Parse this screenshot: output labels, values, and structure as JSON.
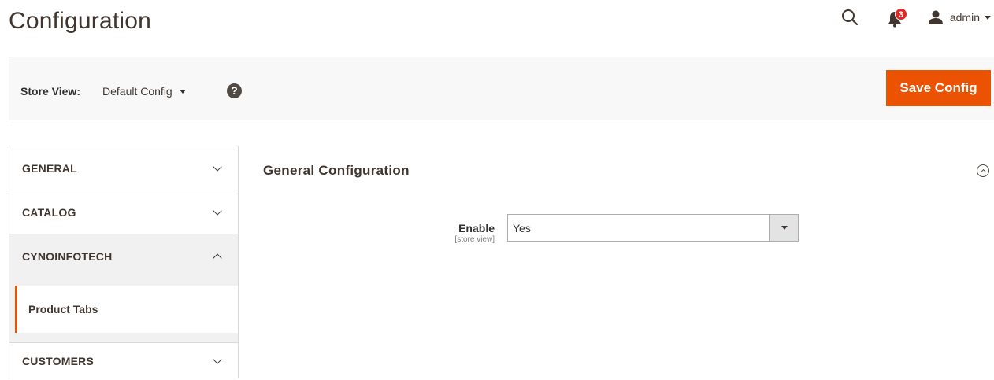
{
  "header": {
    "title": "Configuration",
    "notifications_count": "3",
    "user_name": "admin"
  },
  "store_bar": {
    "label": "Store View:",
    "current": "Default Config",
    "help": "?",
    "save_label": "Save Config"
  },
  "sidebar": {
    "tabs": [
      {
        "label": "GENERAL",
        "state": "collapsed"
      },
      {
        "label": "CATALOG",
        "state": "collapsed"
      },
      {
        "label": "CYNOINFOTECH",
        "state": "expanded"
      },
      {
        "label": "CUSTOMERS",
        "state": "collapsed"
      }
    ],
    "subitems": [
      {
        "label": "Product Tabs",
        "active": true
      }
    ]
  },
  "main": {
    "section_title": "General Configuration",
    "field": {
      "label": "Enable",
      "scope": "[store view]",
      "value": "Yes"
    }
  },
  "colors": {
    "accent": "#eb5202",
    "badge": "#e22626",
    "text": "#41362f"
  }
}
